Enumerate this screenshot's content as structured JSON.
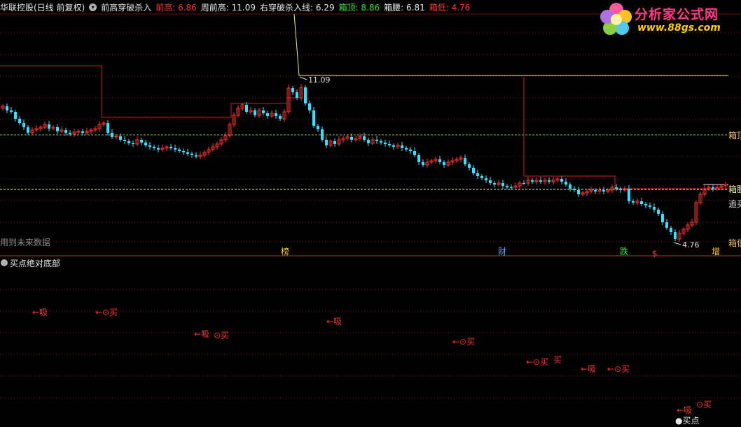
{
  "header": {
    "stock": "华联控股(日线 前复权)",
    "indicator_name": "前高穿破杀入",
    "items": [
      {
        "label": "前高: ",
        "value": "6.86",
        "label_color": "#ff3030",
        "value_color": "#ff3030"
      },
      {
        "label": "周前高: ",
        "value": "11.09",
        "label_color": "#e8e8e8",
        "value_color": "#e8e8e8"
      },
      {
        "label": "右穿破杀入线: ",
        "value": "6.29",
        "label_color": "#e8e8e8",
        "value_color": "#e8e8e8"
      },
      {
        "label": "箱顶: ",
        "value": "8.86",
        "label_color": "#30e030",
        "value_color": "#30e030"
      },
      {
        "label": "箱腰: ",
        "value": "6.81",
        "label_color": "#e8e8e8",
        "value_color": "#e8e8e8"
      },
      {
        "label": "箱低: ",
        "value": "4.76",
        "label_color": "#ff3030",
        "value_color": "#ff3030"
      }
    ]
  },
  "logo": {
    "title": "分析家公式网",
    "url": "www.88gs.com"
  },
  "main_chart": {
    "high_annotation": "11.09",
    "low_annotation": "4.76",
    "right_labels": {
      "box_top": "箱顶",
      "box_mid": "箱腰",
      "chase": "追买",
      "box_low": "箱低"
    },
    "future_data_note": "用到未来数据",
    "event_labels": [
      {
        "text": "榜",
        "color": "#ffcc33"
      },
      {
        "text": "财",
        "color": "#55aaff"
      },
      {
        "text": "跌",
        "color": "#33ee33"
      },
      {
        "text": "$",
        "color": "#ff3030"
      },
      {
        "text": "增",
        "color": "#ffcc33"
      }
    ],
    "colors": {
      "up": "#ff3030",
      "down": "#33e0ff",
      "yellow": "#f2f25a",
      "red_line": "#d02020",
      "box_top_line": "#7fbf3f",
      "box_mid_line": "#f0f0a0",
      "grid": "#7a1818"
    }
  },
  "sub_chart": {
    "title": "买点绝对底部",
    "signals": [
      {
        "text": "←吸"
      },
      {
        "text": "←⊙买"
      },
      {
        "text": "←吸"
      },
      {
        "text": "⊙买"
      },
      {
        "text": "←吸"
      },
      {
        "text": "←⊙买"
      },
      {
        "text": "←⊙买"
      },
      {
        "text": "买"
      },
      {
        "text": "←吸"
      },
      {
        "text": "←⊙买"
      },
      {
        "text": "←吸"
      },
      {
        "text": "⊙买"
      }
    ],
    "buy_point": "●买点",
    "signal_color": "#ff3030"
  }
}
